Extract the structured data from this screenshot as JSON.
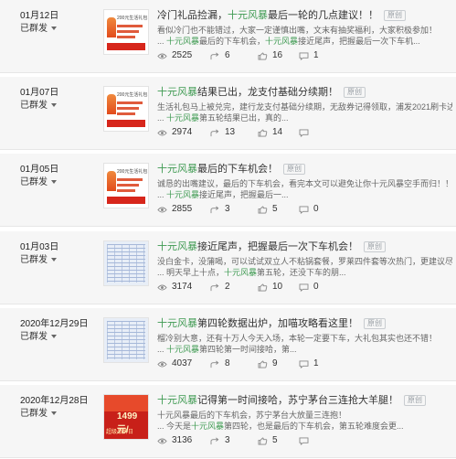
{
  "articles": [
    {
      "date": "01月12日",
      "status": "已群发",
      "title_kw": "十元风暴",
      "title_before": "冷门礼品捡漏，",
      "title_after": "最后一轮的几点建议！！",
      "badge": "原创",
      "desc1": "看似冷门也不能错过，大家一定谨慎出嘴，文末有抽奖福利，大家积极参加！",
      "desc2_prefix": "... ",
      "desc2_kw": "十元风暴",
      "desc2_rest": "最后的下车机会，",
      "desc2_kw2": "十元风暴",
      "desc2_rest2": "接近尾声，把握最后一次下车机...",
      "views": "2525",
      "shares": "6",
      "likes": "16",
      "comments": "1",
      "thumb_type": "promo-card"
    },
    {
      "date": "01月07日",
      "status": "已群发",
      "title_kw": "十元风暴",
      "title_before": "",
      "title_after": "结果已出，龙支付基础分续期！",
      "badge": "原创",
      "desc1": "生活礼包马上被兑完，建行龙支付基础分续期，无敌券记得领取，浦发2021刷卡达标享50...",
      "desc2_prefix": "... ",
      "desc2_kw": "十元风暴",
      "desc2_rest": "第五轮结果已出，真的...",
      "desc2_kw2": "",
      "desc2_rest2": "",
      "views": "2974",
      "shares": "13",
      "likes": "14",
      "comments": "",
      "thumb_type": "promo-card"
    },
    {
      "date": "01月05日",
      "status": "已群发",
      "title_kw": "十元风暴",
      "title_before": "",
      "title_after": "最后的下车机会！",
      "badge": "原创",
      "desc1": "诚恳的出嘴建议，最后的下车机会，看完本文可以避免让你十元风暴空手而归！！",
      "desc2_prefix": "... ",
      "desc2_kw": "十元风暴",
      "desc2_rest": "接近尾声，把握最后一...",
      "desc2_kw2": "",
      "desc2_rest2": "",
      "views": "2855",
      "shares": "3",
      "likes": "5",
      "comments": "0",
      "thumb_type": "promo-card"
    },
    {
      "date": "01月03日",
      "status": "已群发",
      "title_kw": "十元风暴",
      "title_before": "",
      "title_after": "接近尾声，把握最后一次下车机会！",
      "badge": "原创",
      "desc1": "没白金卡，没蒲喝，可以试试双立人不粘锅套餐，罗莱四件套等次热门，更建议尽快拿200...",
      "desc2_prefix": "... 明天早上十点，",
      "desc2_kw": "十元风暴",
      "desc2_rest": "第五轮，还没下车的朋...",
      "desc2_kw2": "",
      "desc2_rest2": "",
      "views": "3174",
      "shares": "2",
      "likes": "10",
      "comments": "0",
      "thumb_type": "table"
    },
    {
      "date": "2020年12月29日",
      "status": "已群发",
      "title_kw": "十元风暴",
      "title_before": "",
      "title_after": "第四轮数据出炉，加喵攻略看这里！",
      "badge": "原创",
      "desc1": "榴冷别大意，还有十万人今天入场，本轮一定要下车，大礼包其实也还不错！",
      "desc2_prefix": "... ",
      "desc2_kw": "十元风暴",
      "desc2_rest": "第四轮第一时间接哈，第...",
      "desc2_kw2": "",
      "desc2_rest2": "",
      "views": "4037",
      "shares": "8",
      "likes": "9",
      "comments": "1",
      "thumb_type": "table"
    },
    {
      "date": "2020年12月28日",
      "status": "已群发",
      "title_kw": "十元风暴",
      "title_before": "",
      "title_after": "记得第一时间接哈，苏宁茅台三连抢大羊腿！",
      "badge": "原创",
      "desc1": "十元风暴最后的下车机会，苏宁茅台大放量三连抱！",
      "desc2_prefix": "... 今天是",
      "desc2_kw": "十元风暴",
      "desc2_rest": "第四轮，也是最后的下车机会，第五轮难度会更...",
      "desc2_kw2": "",
      "desc2_rest2": "",
      "views": "3136",
      "shares": "3",
      "likes": "5",
      "comments": "",
      "thumb_type": "promo-banner"
    }
  ],
  "thumb_text": {
    "card_title": "200元生活礼包",
    "card_price": "¥138",
    "banner_price": "1499元/",
    "banner_text": "超级品牌日"
  },
  "colors": {
    "keyword": "#3f9a52",
    "background": "#f6f6f6",
    "divider": "#e6e6e6"
  },
  "icons": [
    "eye-icon",
    "share-icon",
    "thumbs-up-icon",
    "comment-icon",
    "dropdown-caret-icon"
  ]
}
